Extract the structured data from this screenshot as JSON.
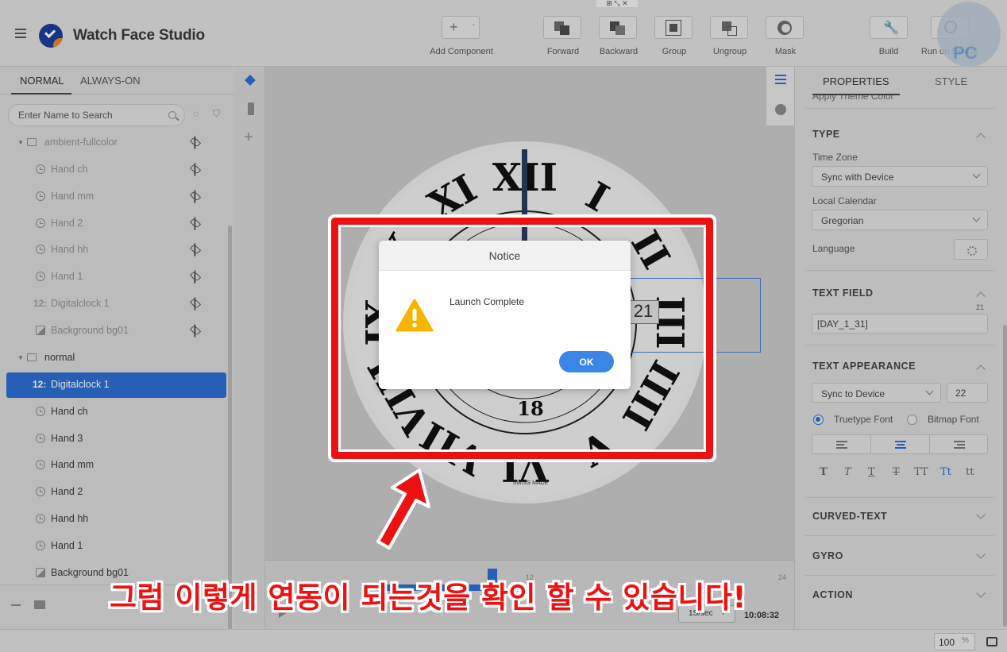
{
  "app": {
    "title": "Watch Face Studio"
  },
  "toolbar": {
    "add_component": "Add Component",
    "forward": "Forward",
    "backward": "Backward",
    "group": "Group",
    "ungroup": "Ungroup",
    "mask": "Mask",
    "build": "Build",
    "run_on_device": "Run on Device"
  },
  "left_panel": {
    "tabs": [
      "NORMAL",
      "ALWAYS-ON"
    ],
    "search_placeholder": "Enter Name to Search",
    "layers": [
      {
        "name": "ambient-fullcolor",
        "type": "folder",
        "icon": "folder-icon",
        "hidden": true
      },
      {
        "name": "Hand ch",
        "type": "hand",
        "icon": "clock-icon",
        "hidden": true
      },
      {
        "name": "Hand mm",
        "type": "hand",
        "icon": "clock-icon",
        "hidden": true
      },
      {
        "name": "Hand 2",
        "type": "hand",
        "icon": "clock-icon",
        "hidden": true
      },
      {
        "name": "Hand hh",
        "type": "hand",
        "icon": "clock-icon",
        "hidden": true
      },
      {
        "name": "Hand 1",
        "type": "hand",
        "icon": "clock-icon",
        "hidden": true
      },
      {
        "name": "Digitalclock 1",
        "type": "digital",
        "icon": "digital-clock-icon",
        "hidden": true
      },
      {
        "name": "Background bg01",
        "type": "image",
        "icon": "image-icon",
        "hidden": true
      },
      {
        "name": "normal",
        "type": "folder",
        "icon": "folder-icon",
        "hidden": false
      },
      {
        "name": "Digitalclock 1",
        "type": "digital",
        "icon": "digital-clock-icon",
        "hidden": false,
        "selected": true
      },
      {
        "name": "Hand ch",
        "type": "hand",
        "icon": "clock-icon",
        "hidden": false
      },
      {
        "name": "Hand 3",
        "type": "hand",
        "icon": "clock-icon",
        "hidden": false
      },
      {
        "name": "Hand mm",
        "type": "hand",
        "icon": "clock-icon",
        "hidden": false
      },
      {
        "name": "Hand 2",
        "type": "hand",
        "icon": "clock-icon",
        "hidden": false
      },
      {
        "name": "Hand hh",
        "type": "hand",
        "icon": "clock-icon",
        "hidden": false
      },
      {
        "name": "Hand 1",
        "type": "hand",
        "icon": "clock-icon",
        "hidden": false
      },
      {
        "name": "Background bg01",
        "type": "image",
        "icon": "image-icon",
        "hidden": false
      }
    ],
    "digital_glyph": "12:"
  },
  "canvas": {
    "date_value": "21",
    "swiss_made": "SWISS MADE",
    "numerals": [
      "XII",
      "I",
      "II",
      "III",
      "IIII",
      "V",
      "VI",
      "VII",
      "VIII",
      "IX",
      "X",
      "XI"
    ],
    "inner_numbers": [
      "18"
    ]
  },
  "timeline": {
    "marker_12": "12",
    "marker_24": "24",
    "speed": "1S/sec",
    "time": "10:08:32"
  },
  "right_panel": {
    "tabs": [
      "PROPERTIES",
      "STYLE"
    ],
    "apply_theme": "Apply Theme Color",
    "type_section": "TYPE",
    "time_zone_label": "Time Zone",
    "time_zone_value": "Sync with Device",
    "calendar_label": "Local Calendar",
    "calendar_value": "Gregorian",
    "language_label": "Language",
    "text_field_section": "TEXT FIELD",
    "text_field_counter": "21",
    "text_field_value": "[DAY_1_31]",
    "text_appearance_section": "TEXT APPEARANCE",
    "font_value": "Sync to Device",
    "font_size": "22",
    "truetype_label": "Truetype Font",
    "bitmap_label": "Bitmap Font",
    "case_buttons": [
      "T",
      "T",
      "T",
      "T",
      "TT",
      "Tt",
      "tt"
    ],
    "curved_text_section": "CURVED-TEXT",
    "gyro_section": "GYRO",
    "action_section": "ACTION"
  },
  "dialog": {
    "title": "Notice",
    "message": "Launch Complete",
    "ok": "OK"
  },
  "status": {
    "zoom": "100",
    "zoom_unit": "%"
  },
  "annotation": {
    "caption": "그럼 이렇게 연동이 되는것을 확인 할 수 있습니다!",
    "watermark": "PC"
  },
  "colors": {
    "accent": "#2d6bd0",
    "callout_red": "#ee1111",
    "ok_button": "#3a86e8",
    "warning": "#f7b500"
  }
}
